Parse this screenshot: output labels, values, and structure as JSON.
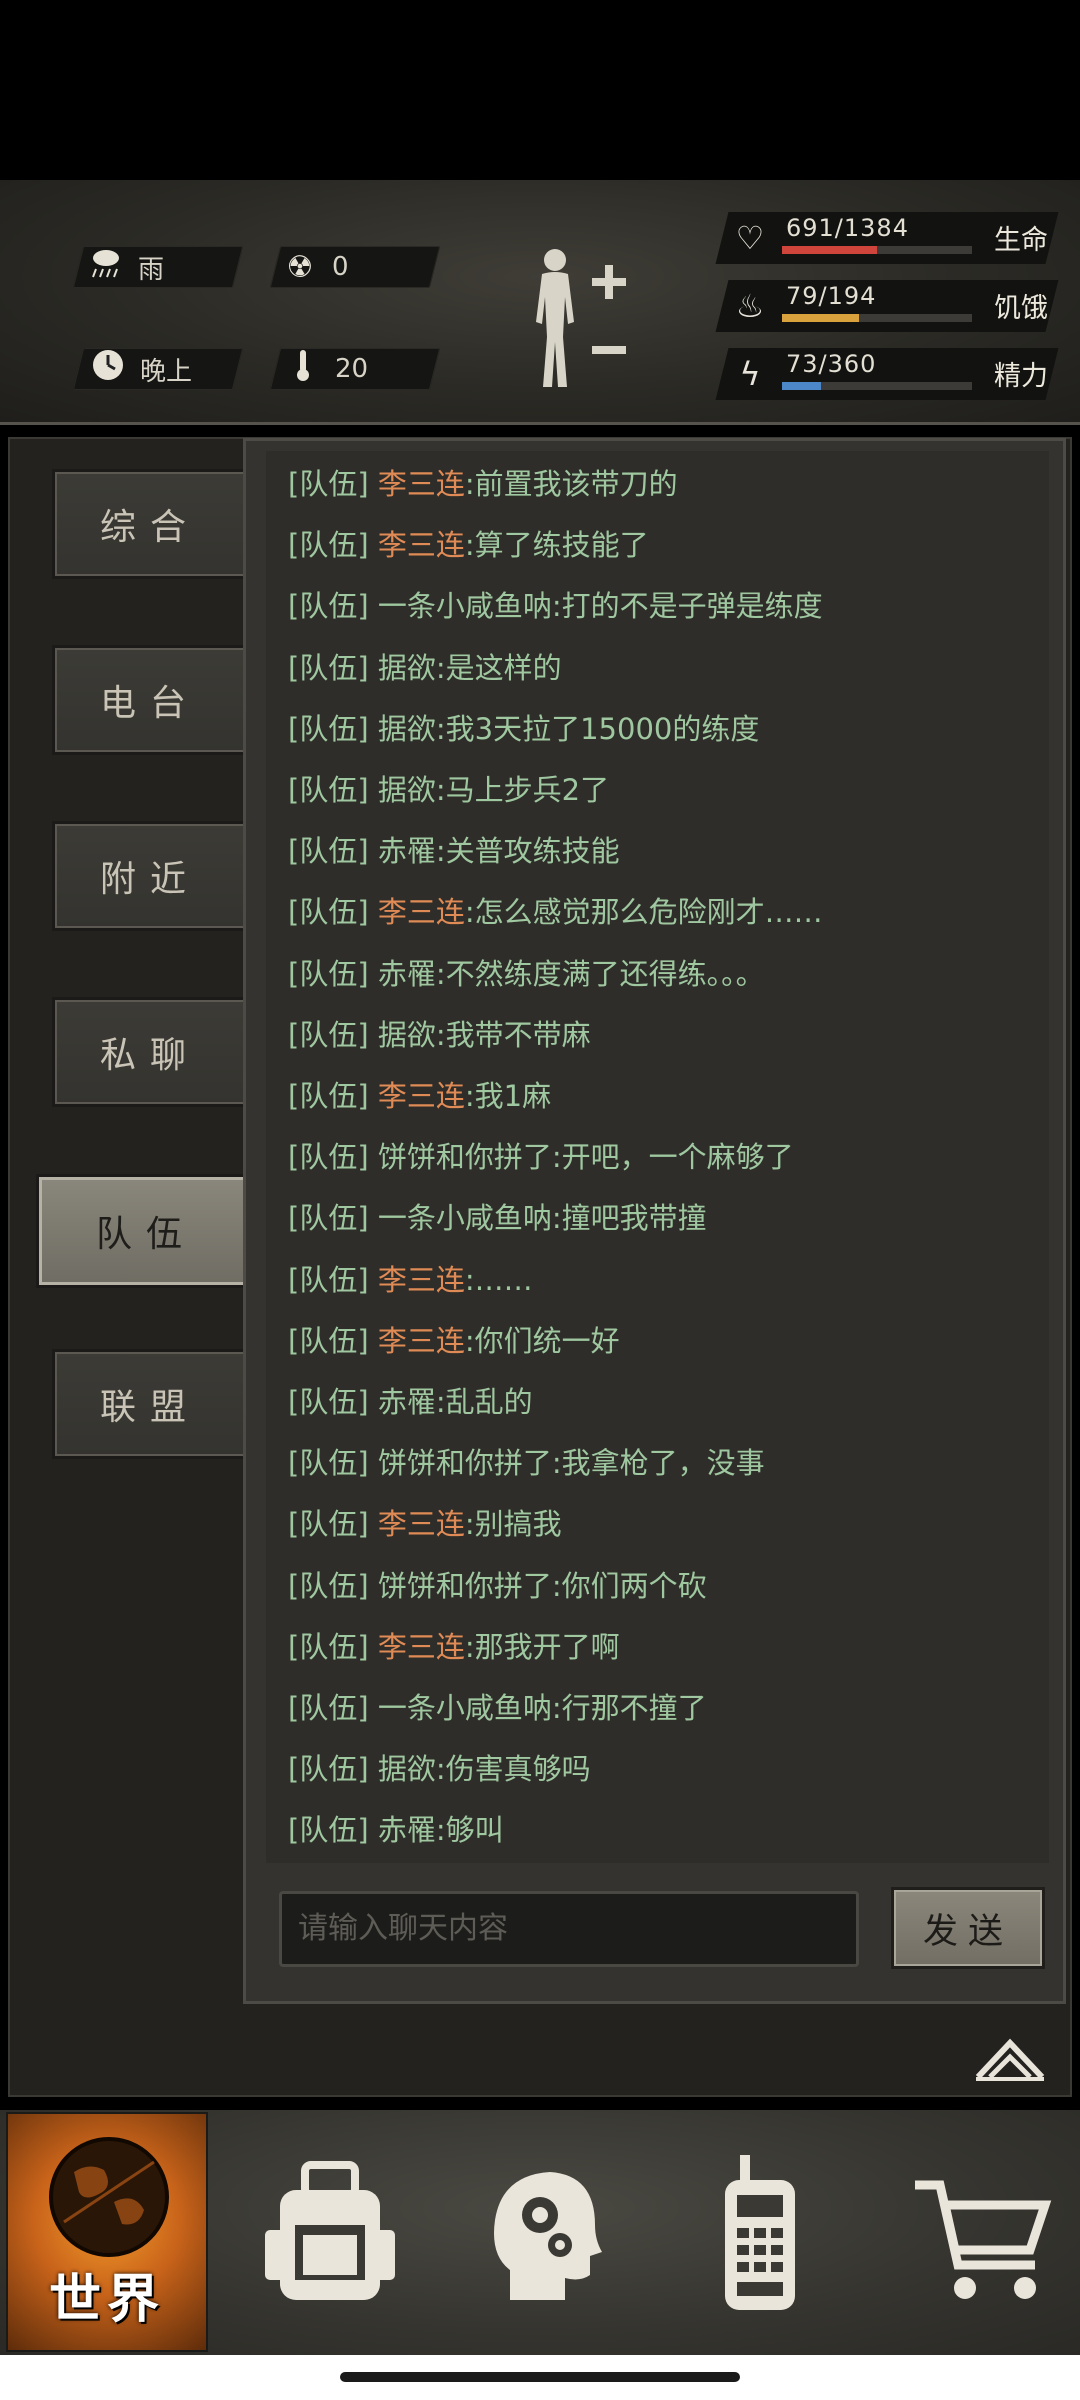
{
  "hud": {
    "weather": {
      "icon": "rain-icon",
      "label": "雨"
    },
    "radiation": {
      "icon": "radiation-icon",
      "value": "0"
    },
    "time_of_day": {
      "icon": "clock-icon",
      "label": "晚上"
    },
    "temperature": {
      "icon": "thermometer-icon",
      "value": "20"
    },
    "stats": [
      {
        "icon": "heart-icon",
        "value": "691/1384",
        "label": "生命",
        "fraction": 0.4993,
        "color": "#d0453b"
      },
      {
        "icon": "stomach-icon",
        "value": "79/194",
        "label": "饥饿",
        "fraction": 0.407,
        "color": "#d9a23c"
      },
      {
        "icon": "energy-icon",
        "value": "73/360",
        "label": "精力",
        "fraction": 0.203,
        "color": "#4b87c9"
      }
    ]
  },
  "tabs": [
    {
      "label": "综合",
      "active": false
    },
    {
      "label": "电台",
      "active": false
    },
    {
      "label": "附近",
      "active": false
    },
    {
      "label": "私聊",
      "active": false
    },
    {
      "label": "队伍",
      "active": true
    },
    {
      "label": "联盟",
      "active": false
    }
  ],
  "chat": {
    "channel_tag": "[队伍]",
    "messages": [
      {
        "name": "李三连",
        "text": ":前置我该带刀的",
        "name_color": "orange"
      },
      {
        "name": "李三连",
        "text": ":算了练技能了",
        "name_color": "orange"
      },
      {
        "name": "一条小咸鱼呐",
        "text": ":打的不是子弹是练度",
        "name_color": "green"
      },
      {
        "name": "据欲",
        "text": ":是这样的",
        "name_color": "green"
      },
      {
        "name": "据欲",
        "text": ":我3天拉了15000的练度",
        "name_color": "green"
      },
      {
        "name": "据欲",
        "text": ":马上步兵2了",
        "name_color": "green"
      },
      {
        "name": "赤罹",
        "text": ":关普攻练技能",
        "name_color": "green"
      },
      {
        "name": "李三连",
        "text": ":怎么感觉那么危险刚才……",
        "name_color": "orange"
      },
      {
        "name": "赤罹",
        "text": ":不然练度满了还得练。。。",
        "name_color": "green"
      },
      {
        "name": "据欲",
        "text": ":我带不带麻",
        "name_color": "green"
      },
      {
        "name": "李三连",
        "text": ":我1麻",
        "name_color": "orange"
      },
      {
        "name": "饼饼和你拼了",
        "text": ":开吧，一个麻够了",
        "name_color": "green"
      },
      {
        "name": "一条小咸鱼呐",
        "text": ":撞吧我带撞",
        "name_color": "green"
      },
      {
        "name": "李三连",
        "text": ":……",
        "name_color": "orange"
      },
      {
        "name": "李三连",
        "text": ":你们统一好",
        "name_color": "orange"
      },
      {
        "name": "赤罹",
        "text": ":乱乱的",
        "name_color": "green"
      },
      {
        "name": "饼饼和你拼了",
        "text": ":我拿枪了，没事",
        "name_color": "green"
      },
      {
        "name": "李三连",
        "text": ":别搞我",
        "name_color": "orange"
      },
      {
        "name": "饼饼和你拼了",
        "text": ":你们两个砍",
        "name_color": "green"
      },
      {
        "name": "李三连",
        "text": ":那我开了啊",
        "name_color": "orange"
      },
      {
        "name": "一条小咸鱼呐",
        "text": ":行那不撞了",
        "name_color": "green"
      },
      {
        "name": "据欲",
        "text": ":伤害真够吗",
        "name_color": "green"
      },
      {
        "name": "赤罹",
        "text": ":够叫",
        "name_color": "green"
      }
    ],
    "input_placeholder": "请输入聊天内容",
    "send_label": "发送"
  },
  "bottom_nav": {
    "world_label": "世界",
    "items": [
      "backpack-icon",
      "skills-head-icon",
      "radio-phone-icon",
      "shop-cart-icon"
    ]
  },
  "colors": {
    "orange_name": "#e08a55",
    "green_text": "#9fc7a0",
    "world_accent": "#f39a2a"
  }
}
